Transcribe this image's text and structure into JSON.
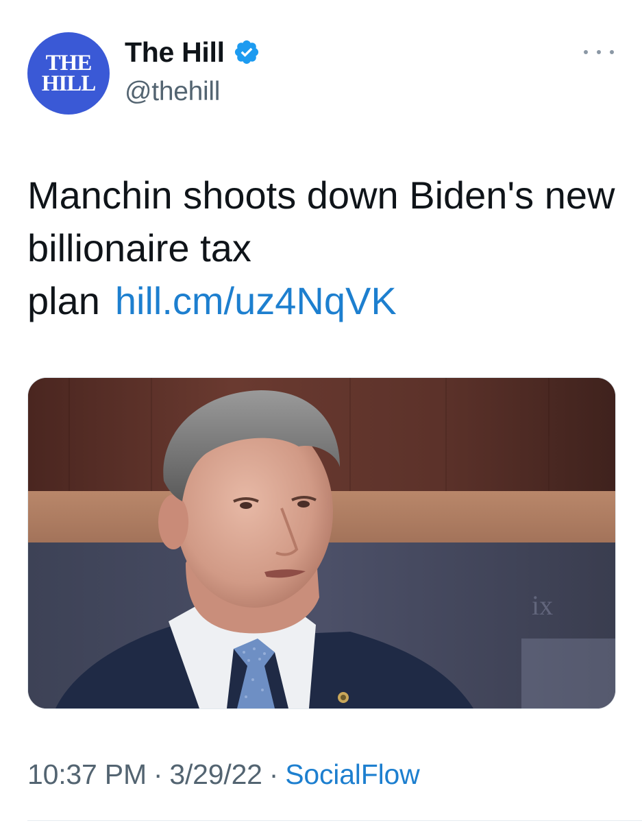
{
  "tweet": {
    "author": {
      "avatar_lines": [
        "THE",
        "HILL"
      ],
      "display_name": "The Hill",
      "handle": "@thehill",
      "verified": true,
      "verified_icon": "verified-badge-icon"
    },
    "more_icon": "more-options-icon",
    "text": "Manchin shoots down Biden's new billionaire tax plan",
    "link": "hill.cm/uz4NqVK",
    "media": {
      "type": "photo"
    },
    "time": "10:37 PM",
    "separator": "·",
    "date": "3/29/22",
    "source": "SocialFlow"
  },
  "colors": {
    "text": "#0f1419",
    "secondary": "#536471",
    "link": "#1d7fcf",
    "avatar_bg": "#3a59d6",
    "verified": "#1d9bf0"
  }
}
